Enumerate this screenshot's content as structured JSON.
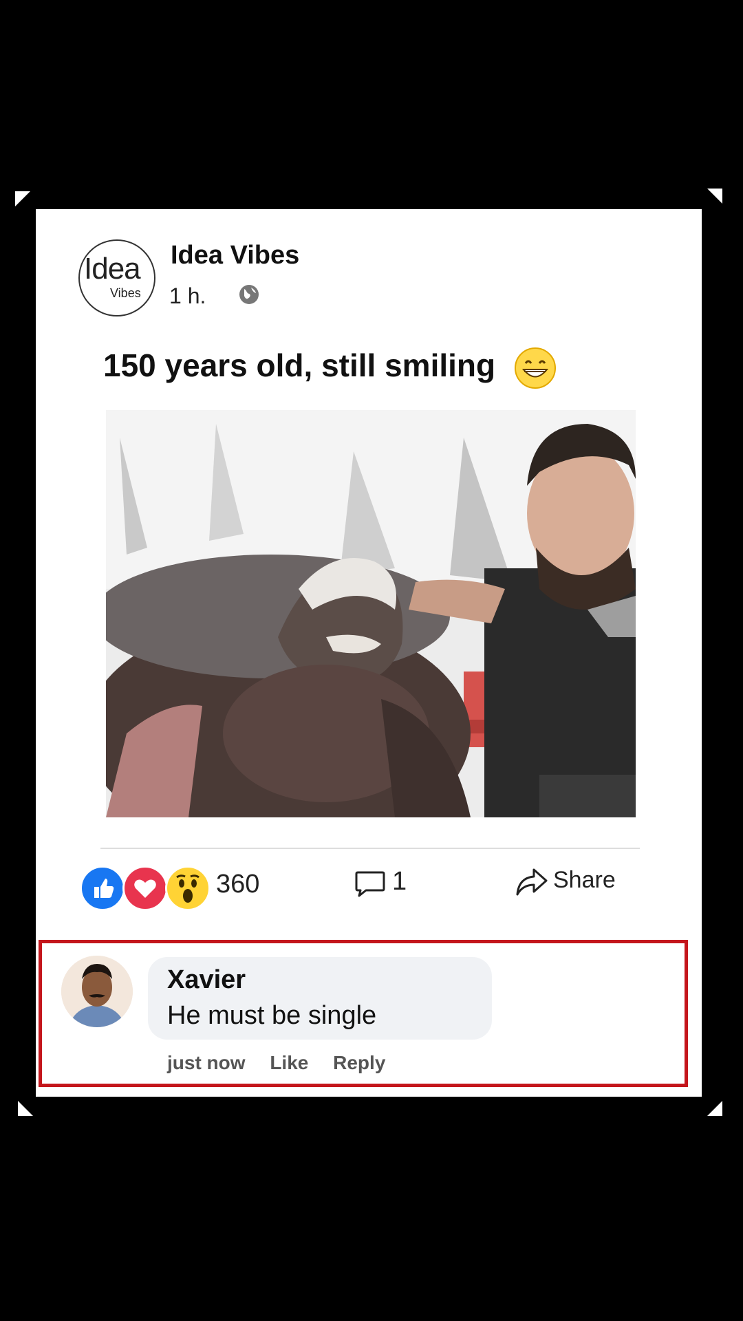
{
  "post": {
    "page_name": "Idea Vibes",
    "avatar_main": "Idea",
    "avatar_sub": "Vibes",
    "time": "1 h.",
    "text": "150 years old, still smiling",
    "image_description_icon": "photo"
  },
  "stats": {
    "reaction_count": "360",
    "comment_count": "1",
    "share_label": "Share"
  },
  "comment": {
    "author": "Xavier",
    "text": "He must be single",
    "time": "just now",
    "like_label": "Like",
    "reply_label": "Reply"
  },
  "colors": {
    "like": "#1877f2",
    "love": "#e8344e",
    "wow": "#ffd335",
    "highlight": "#c4161c"
  }
}
